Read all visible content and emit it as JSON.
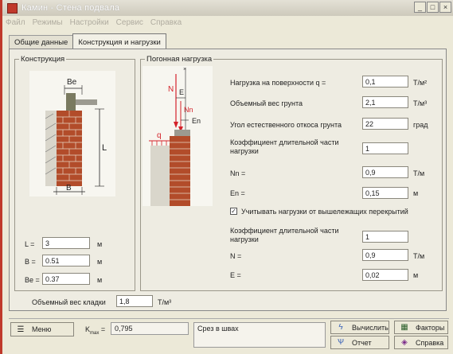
{
  "window": {
    "title": "Камин - Стена подвала",
    "minimize": "_",
    "maximize": "□",
    "close": "×"
  },
  "menu": [
    "Файл",
    "Режимы",
    "Настройки",
    "Сервис",
    "Справка"
  ],
  "tabs": [
    "Общие данные",
    "Конструкция и нагрузки"
  ],
  "construction": {
    "title": "Конструкция",
    "fields": [
      {
        "label": "L =",
        "value": "3",
        "unit": "м"
      },
      {
        "label": "B =",
        "value": "0.51",
        "unit": "м"
      },
      {
        "label": "Be =",
        "value": "0.37",
        "unit": "м"
      }
    ],
    "diagram": {
      "be": "Bе",
      "l": "L",
      "b": "B"
    }
  },
  "load": {
    "title": "Погонная нагрузка",
    "diagram": {
      "n": "N",
      "e": "E",
      "nn": "Nn",
      "en": "En",
      "q": "q"
    },
    "rows": [
      {
        "label": "Нагрузка на поверхности q =",
        "value": "0,1",
        "unit": "Т/м²"
      },
      {
        "label": "Объемный вес грунта",
        "value": "2,1",
        "unit": "Т/м³"
      },
      {
        "label": "Угол естественного откоса грунта",
        "value": "22",
        "unit": "град"
      },
      {
        "label": "Коэффициент длительной части\nнагрузки",
        "value": "1",
        "unit": ""
      },
      {
        "label": "Nn =",
        "value": "0,9",
        "unit": "Т/м"
      },
      {
        "label": "En =",
        "value": "0,15",
        "unit": "м"
      },
      {
        "label": "Коэффициент длительной части\nнагрузки",
        "value": "1",
        "unit": ""
      },
      {
        "label": "N =",
        "value": "0,9",
        "unit": "Т/м"
      },
      {
        "label": "E =",
        "value": "0,02",
        "unit": "м"
      }
    ],
    "checkbox": {
      "label": "Учитывать нагрузки от вышележащих перекрытий",
      "checked": true,
      "mark": "✓"
    }
  },
  "masonry": {
    "label": "Объемный вес кладки",
    "value": "1,8",
    "unit": "Т/м³"
  },
  "status": {
    "menu_label": "Меню",
    "kmax_label": "K",
    "kmax_sub": "max",
    "kmax_eq": "=",
    "kmax_value": "0,795",
    "message": "Срез в шваx",
    "calc": "Вычислить",
    "report": "Отчет",
    "factors": "Факторы",
    "help": "Справка"
  },
  "colors": {
    "accent_red": "#c0392b",
    "brick": "#b24c2a",
    "load_red": "#d4222a",
    "grey_bg": "#ece9d8"
  }
}
